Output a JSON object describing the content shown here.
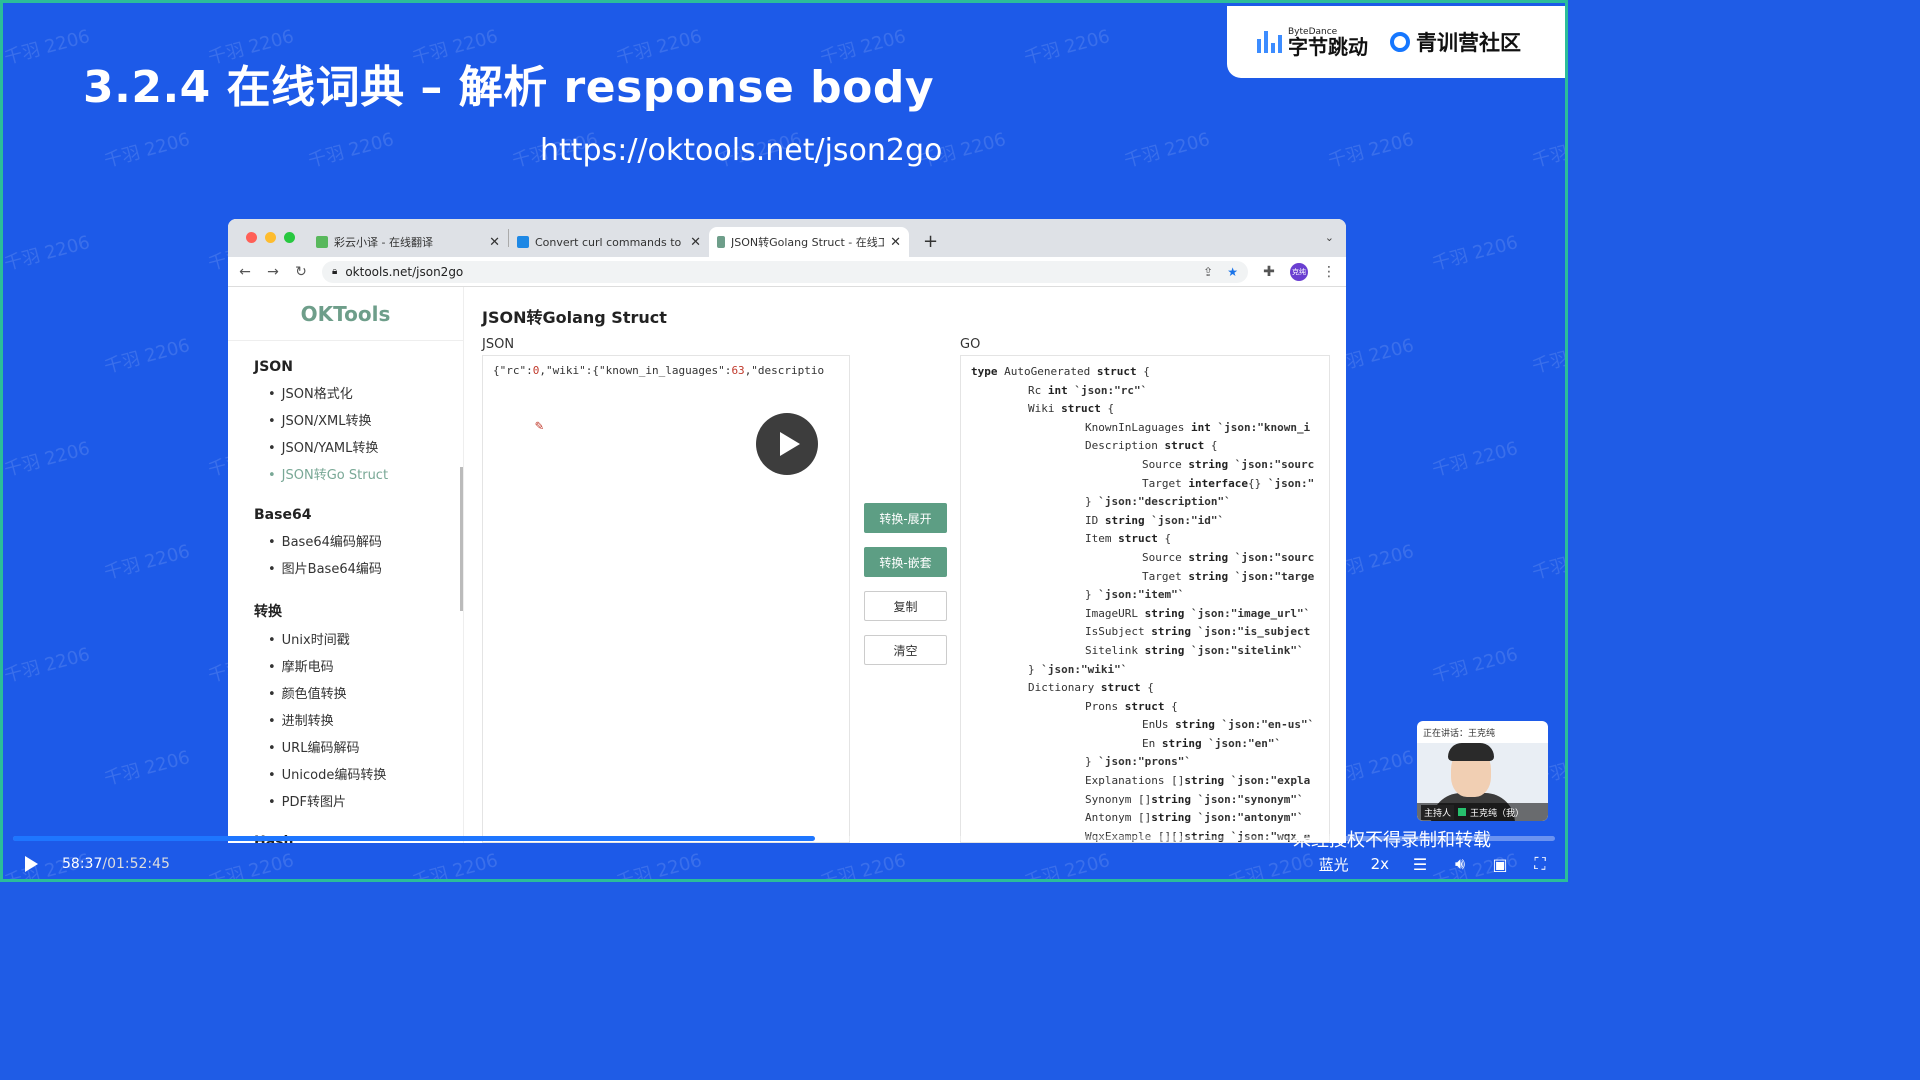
{
  "slide": {
    "title": "3.2.4 在线词典 – 解析 response body",
    "url": "https://oktools.net/json2go"
  },
  "brand": {
    "bytedance_small": "ByteDance",
    "bytedance_big": "字节跳动",
    "community": "青训营社区"
  },
  "browser": {
    "tabs": [
      {
        "label": "彩云小译 - 在线翻译",
        "favicon_color": "#58b85c"
      },
      {
        "label": "Convert curl commands to cod",
        "favicon_color": "#1e88e5"
      },
      {
        "label": "JSON转Golang Struct - 在线工",
        "favicon_color": "#6e9e8a",
        "active": true
      }
    ],
    "address": "oktools.net/json2go",
    "profile_initials": "克纯"
  },
  "sidebar": {
    "logo": "OKTools",
    "groups": [
      {
        "title": "JSON",
        "items": [
          "JSON格式化",
          "JSON/XML转换",
          "JSON/YAML转换",
          "JSON转Go Struct"
        ],
        "active_index": 3
      },
      {
        "title": "Base64",
        "items": [
          "Base64编码解码",
          "图片Base64编码"
        ]
      },
      {
        "title": "转换",
        "items": [
          "Unix时间戳",
          "摩斯电码",
          "颜色值转换",
          "进制转换",
          "URL编码解码",
          "Unicode编码转换",
          "PDF转图片"
        ]
      },
      {
        "title": "Hash",
        "items": []
      }
    ]
  },
  "main": {
    "heading": "JSON转Golang Struct",
    "json_label": "JSON",
    "go_label": "GO",
    "json_input": "{\"rc\":0,\"wiki\":{\"known_in_laguages\":63,\"descriptio",
    "buttons": [
      "转换-展开",
      "转换-嵌套",
      "复制",
      "清空"
    ],
    "go_output": [
      {
        "indent": 0,
        "text": "type AutoGenerated struct {"
      },
      {
        "indent": 1,
        "text": "Rc int `json:\"rc\"`"
      },
      {
        "indent": 1,
        "text": "Wiki struct {"
      },
      {
        "indent": 2,
        "text": "KnownInLaguages int `json:\"known_i"
      },
      {
        "indent": 2,
        "text": "Description struct {"
      },
      {
        "indent": 3,
        "text": "Source string `json:\"sourc"
      },
      {
        "indent": 3,
        "text": "Target interface{} `json:\""
      },
      {
        "indent": 2,
        "text": "} `json:\"description\"`"
      },
      {
        "indent": 2,
        "text": "ID string `json:\"id\"`"
      },
      {
        "indent": 2,
        "text": "Item struct {"
      },
      {
        "indent": 3,
        "text": "Source string `json:\"sourc"
      },
      {
        "indent": 3,
        "text": "Target string `json:\"targe"
      },
      {
        "indent": 2,
        "text": "} `json:\"item\"`"
      },
      {
        "indent": 2,
        "text": "ImageURL string `json:\"image_url\"`"
      },
      {
        "indent": 2,
        "text": "IsSubject string `json:\"is_subject"
      },
      {
        "indent": 2,
        "text": "Sitelink string `json:\"sitelink\"`"
      },
      {
        "indent": 1,
        "text": "} `json:\"wiki\"`"
      },
      {
        "indent": 1,
        "text": "Dictionary struct {"
      },
      {
        "indent": 2,
        "text": "Prons struct {"
      },
      {
        "indent": 3,
        "text": "EnUs string `json:\"en-us\"`"
      },
      {
        "indent": 3,
        "text": "En string `json:\"en\"`"
      },
      {
        "indent": 2,
        "text": "} `json:\"prons\"`"
      },
      {
        "indent": 2,
        "text": "Explanations []string `json:\"expla"
      },
      {
        "indent": 2,
        "text": "Synonym []string `json:\"synonym\"`"
      },
      {
        "indent": 2,
        "text": "Antonym []string `json:\"antonym\"`"
      },
      {
        "indent": 2,
        "text": "WqxExample [][]string `json:\"wqx_e"
      }
    ]
  },
  "webcam": {
    "speaking_label": "正在讲话：王克纯",
    "host_label": "主持人",
    "name": "王克纯（我）"
  },
  "watermark": "千羽 2206",
  "notice": "未经授权不得录制和转载",
  "player": {
    "current_time": "58:37",
    "duration": "/01:52:45",
    "progress": 0.52,
    "quality": "蓝光",
    "speed": "2x"
  }
}
